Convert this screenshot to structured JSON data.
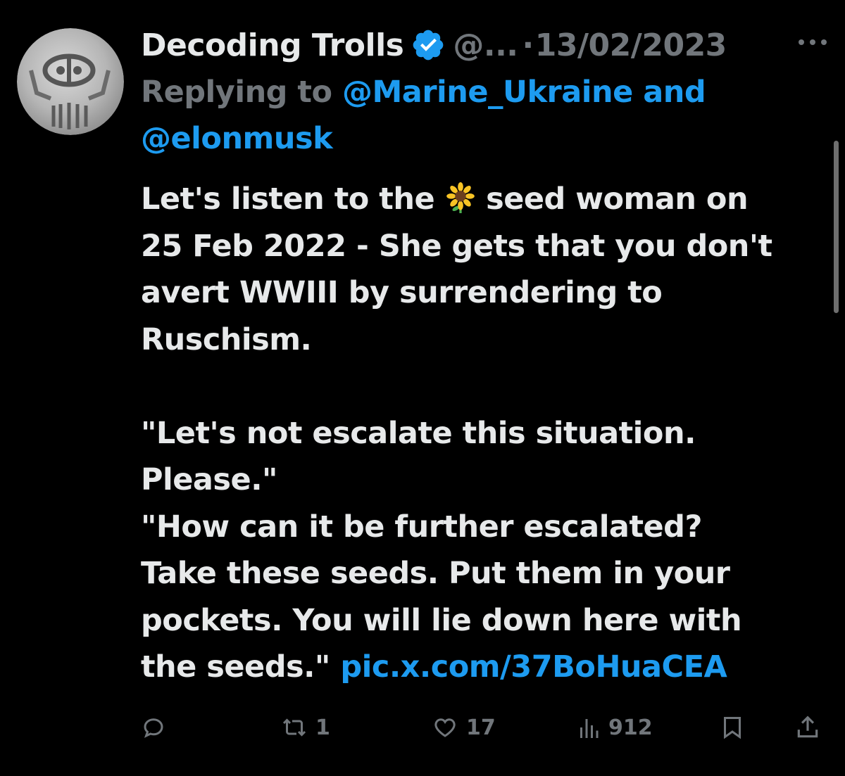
{
  "tweet": {
    "author": {
      "name": "Decoding Trolls",
      "handle": "@...",
      "avatar_icon": "stone-seal-avatar",
      "verified_icon": "verified-badge-icon"
    },
    "separator": "·",
    "date": "13/02/2023",
    "more_icon": "more-options-icon",
    "reply": {
      "prefix": "Replying to",
      "mention_1": "@Marine_Ukraine",
      "conjunction": "and",
      "mention_2": "@elonmusk"
    },
    "body": {
      "line_1_before_emoji": "Let's listen to the",
      "emoji": "sunflower-emoji",
      "line_1_after_emoji": "seed woman on",
      "line_2": "25 Feb 2022 - She gets that you don't",
      "line_3": "avert WWIII by surrendering to",
      "line_4": "Ruschism.",
      "line_5": "\"Let's not escalate this situation.",
      "line_6": "Please.\"",
      "line_7": "\"How can it be further escalated?",
      "line_8": "Take these seeds. Put them in your",
      "line_9": "pockets. You will lie down here with",
      "line_10_text": "the seeds.\"",
      "link": "pic.x.com/37BoHuaCEA"
    },
    "actions": {
      "reply": {
        "icon": "reply-bubble-icon",
        "count": ""
      },
      "repost": {
        "icon": "repost-icon",
        "count": "1"
      },
      "like": {
        "icon": "heart-icon",
        "count": "17"
      },
      "views": {
        "icon": "views-bar-chart-icon",
        "count": "912"
      },
      "bookmark": {
        "icon": "bookmark-icon"
      },
      "share": {
        "icon": "share-upload-icon"
      }
    },
    "colors": {
      "background": "#000000",
      "text": "#e7e9ea",
      "muted": "#71767b",
      "accent": "#1d9bf0",
      "verified": "#1d9bf0"
    }
  }
}
